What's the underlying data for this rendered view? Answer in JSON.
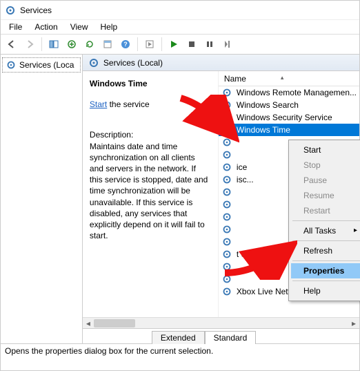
{
  "window": {
    "title": "Services"
  },
  "menu": {
    "file": "File",
    "action": "Action",
    "view": "View",
    "help": "Help"
  },
  "toolbar_icons": {
    "back": "back-arrow-icon",
    "forward": "forward-arrow-icon",
    "showhide": "show-hide-tree-icon",
    "export": "export-list-icon",
    "refresh": "refresh-icon",
    "properties": "properties-icon",
    "help": "help-icon",
    "start": "start-service-icon",
    "play": "play-icon",
    "stop": "stop-icon",
    "pause": "pause-icon",
    "restart": "restart-icon"
  },
  "tree": {
    "root": "Services (Loca"
  },
  "list_header": {
    "title": "Services (Local)"
  },
  "details": {
    "service_name": "Windows Time",
    "start_link": "Start",
    "start_suffix": " the service",
    "desc_label": "Description:",
    "desc_text": "Maintains date and time synchronization on all clients and servers in the network. If this service is stopped, date and time synchronization will be unavailable. If this service is disabled, any services that explicitly depend on it will fail to start."
  },
  "grid": {
    "col_name": "Name",
    "rows": [
      "Windows Remote Managemen...",
      "Windows Search",
      "Windows Security Service",
      "Windows Time",
      "",
      "",
      "ice",
      "isc...",
      "",
      "",
      "",
      "",
      "",
      "t S...",
      "",
      "",
      "Xbox Live Networking Service"
    ],
    "selected_index": 3
  },
  "tabs": {
    "extended": "Extended",
    "standard": "Standard"
  },
  "context_menu": {
    "start": "Start",
    "stop": "Stop",
    "pause": "Pause",
    "resume": "Resume",
    "restart": "Restart",
    "all_tasks": "All Tasks",
    "refresh": "Refresh",
    "properties": "Properties",
    "help": "Help"
  },
  "statusbar": {
    "text": "Opens the properties dialog box for the current selection."
  }
}
